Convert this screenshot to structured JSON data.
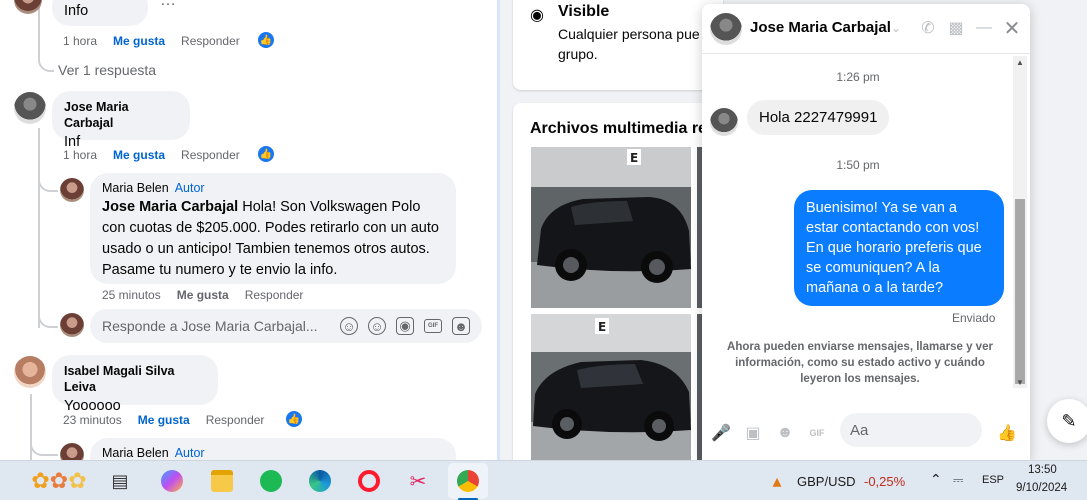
{
  "comments": {
    "top": {
      "text": "Info",
      "time": "1 hora",
      "like": "Me gusta",
      "reply": "Responder"
    },
    "view_replies": "Ver 1 respuesta",
    "jose": {
      "name": "Jose Maria Carbajal",
      "text": "Inf",
      "time": "1 hora",
      "like": "Me gusta",
      "reply": "Responder"
    },
    "maria1": {
      "name": "Maria Belen",
      "author": "Autor",
      "mention": "Jose Maria Carbajal",
      "text": " Hola! Son Volkswagen Polo con cuotas de $205.000. Podes retirarlo con un auto usado o un anticipo! Tambien tenemos otros autos. Pasame tu numero y te envio la info.",
      "time": "25 minutos",
      "like": "Me gusta",
      "reply": "Responder"
    },
    "reply_placeholder": "Responde a Jose Maria Carbajal...",
    "isabel": {
      "name": "Isabel Magali Silva Leiva",
      "text": "Yoooooo",
      "time": "23 minutos",
      "like": "Me gusta",
      "reply": "Responder"
    },
    "maria2": {
      "name": "Maria Belen",
      "author": "Autor"
    }
  },
  "group_info": {
    "visible_title": "Visible",
    "visible_desc_line1": "Cualquier persona pue",
    "visible_desc_line2": "grupo.",
    "media_title": "Archivos multimedia re"
  },
  "chat": {
    "contact": "Jose Maria Carbajal",
    "ts1": "1:26 pm",
    "incoming": "Hola 2227479991",
    "ts2": "1:50 pm",
    "outgoing": "Buenisimo! Ya se van a estar contactando con vos! En que horario preferis que se comuniquen? A la mañana o a la tarde?",
    "status": "Enviado",
    "notice": "Ahora pueden enviarse mensajes, llamarse y ver información, como su estado activo y cuándo leyeron los mensajes.",
    "input_placeholder": "Aa"
  },
  "taskbar": {
    "ticker": "GBP/USD",
    "change": "-0,25%",
    "lang": "ESP",
    "time": "13:50",
    "date": "9/10/2024",
    "colors": {
      "negative": "#c42b1c",
      "accent": "#0a7cff",
      "fb_blue": "#1877f2"
    }
  }
}
